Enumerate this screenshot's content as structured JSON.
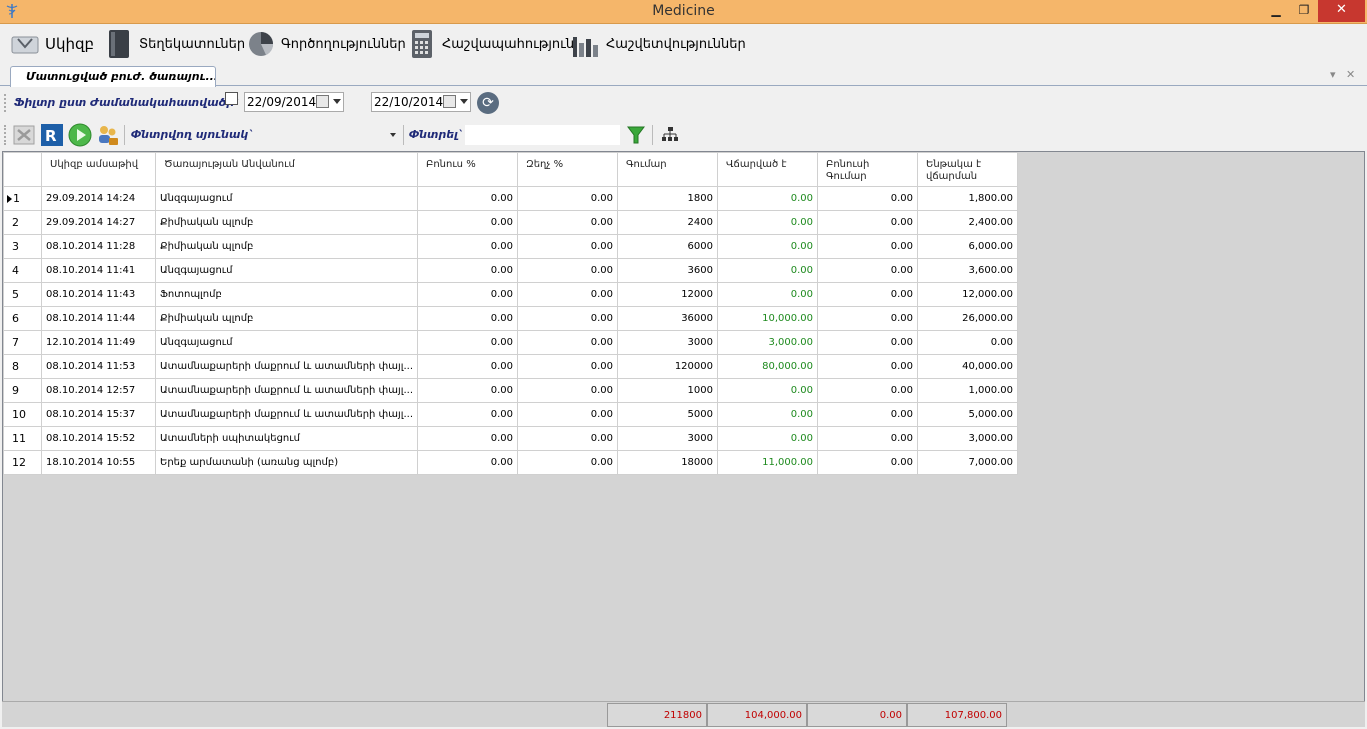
{
  "window": {
    "title": "Medicine",
    "minimize": "▁",
    "maximize": "❐",
    "close": "✕"
  },
  "menu": [
    {
      "label": "Սկիզբ",
      "icon": "home-icon"
    },
    {
      "label": "Տեղեկատուներ",
      "icon": "book-icon"
    },
    {
      "label": "Գործողություններ",
      "icon": "pie-chart-icon"
    },
    {
      "label": "Հաշվապահություն",
      "icon": "calculator-icon"
    },
    {
      "label": "Հաշվետվություններ",
      "icon": "bar-chart-icon"
    }
  ],
  "tab": {
    "label": "Մատուցված բուժ. ծառայու..."
  },
  "filter": {
    "label": "Ֆիլտր ըստ Ժամանակահատվածի`",
    "date_from": "22/09/2014",
    "date_to": "22/10/2014"
  },
  "toolbar": {
    "search_column_label": "Փնտրվող սյունակ`",
    "search_label": "Փնտրել`",
    "search_value": ""
  },
  "table": {
    "columns": [
      "",
      "Սկիզբ ամսաթիվ",
      "Ծառայության Անվանում",
      "Բոնուս %",
      "Զեղչ %",
      "Գումար",
      "Վճարված է",
      "Բոնուսի Գումար",
      "Ենթակա է վճարման"
    ],
    "rows": [
      [
        "1",
        "29.09.2014 14:24",
        "Անզգայացում",
        "0.00",
        "0.00",
        "1800",
        "0.00",
        "0.00",
        "1,800.00"
      ],
      [
        "2",
        "29.09.2014 14:27",
        "Քիմիական պլոմբ",
        "0.00",
        "0.00",
        "2400",
        "0.00",
        "0.00",
        "2,400.00"
      ],
      [
        "3",
        "08.10.2014 11:28",
        "Քիմիական պլոմբ",
        "0.00",
        "0.00",
        "6000",
        "0.00",
        "0.00",
        "6,000.00"
      ],
      [
        "4",
        "08.10.2014 11:41",
        "Անզգայացում",
        "0.00",
        "0.00",
        "3600",
        "0.00",
        "0.00",
        "3,600.00"
      ],
      [
        "5",
        "08.10.2014 11:43",
        "Ֆոտոպլոմբ",
        "0.00",
        "0.00",
        "12000",
        "0.00",
        "0.00",
        "12,000.00"
      ],
      [
        "6",
        "08.10.2014 11:44",
        "Քիմիական պլոմբ",
        "0.00",
        "0.00",
        "36000",
        "10,000.00",
        "0.00",
        "26,000.00"
      ],
      [
        "7",
        "12.10.2014 11:49",
        "Անզգայացում",
        "0.00",
        "0.00",
        "3000",
        "3,000.00",
        "0.00",
        "0.00"
      ],
      [
        "8",
        "08.10.2014 11:53",
        "Ատամնաքարերի մաքրում և ատամների փայլ...",
        "0.00",
        "0.00",
        "120000",
        "80,000.00",
        "0.00",
        "40,000.00"
      ],
      [
        "9",
        "08.10.2014 12:57",
        "Ատամնաքարերի մաքրում և ատամների փայլ...",
        "0.00",
        "0.00",
        "1000",
        "0.00",
        "0.00",
        "1,000.00"
      ],
      [
        "10",
        "08.10.2014 15:37",
        "Ատամնաքարերի մաքրում և ատամների փայլ...",
        "0.00",
        "0.00",
        "5000",
        "0.00",
        "0.00",
        "5,000.00"
      ],
      [
        "11",
        "08.10.2014 15:52",
        "Ատամների սպիտակեցում",
        "0.00",
        "0.00",
        "3000",
        "0.00",
        "0.00",
        "3,000.00"
      ],
      [
        "12",
        "18.10.2014 10:55",
        "Երեք արմատանի (առանց պլոմբ)",
        "0.00",
        "0.00",
        "18000",
        "11,000.00",
        "0.00",
        "7,000.00"
      ]
    ]
  },
  "totals": {
    "amount": "211800",
    "paid": "104,000.00",
    "bonus": "0.00",
    "due": "107,800.00"
  },
  "colors": {
    "titlebar": "#f5b66a",
    "paid_text": "#1e8a1e",
    "totals_text": "#c00000",
    "label_text": "#1f2a78"
  }
}
